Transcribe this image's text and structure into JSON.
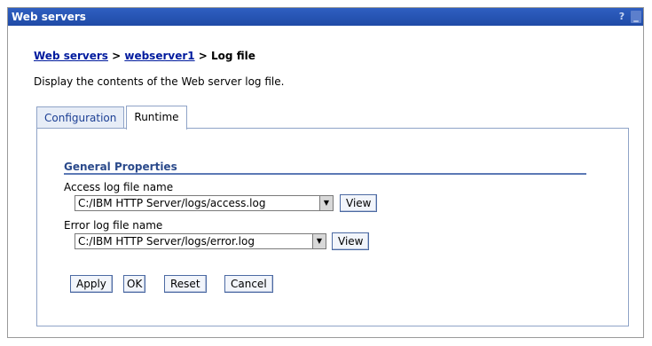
{
  "window": {
    "title": "Web servers",
    "help_label": "?",
    "minimize_label": "_"
  },
  "breadcrumb": {
    "link1": "Web servers",
    "sep1": " > ",
    "link2": "webserver1",
    "sep2": " > ",
    "current": "Log file"
  },
  "description": "Display the contents of the Web server log file.",
  "tabs": [
    {
      "label": "Configuration",
      "active": false
    },
    {
      "label": "Runtime",
      "active": true
    }
  ],
  "general_properties": {
    "title": "General Properties",
    "access_log": {
      "label": "Access log file name",
      "value": "C:/IBM HTTP Server/logs/access.log",
      "view_label": "View"
    },
    "error_log": {
      "label": "Error log file name",
      "value": "C:/IBM HTTP Server/logs/error.log",
      "view_label": "View"
    }
  },
  "buttons": {
    "apply": "Apply",
    "ok": "OK",
    "reset": "Reset",
    "cancel": "Cancel"
  },
  "icons": {
    "dropdown_arrow": "▼"
  },
  "colors": {
    "titlebar": "#2f5fc1",
    "link": "#001b9e",
    "section_title": "#2b4a8b",
    "border": "#8fa3c7"
  }
}
